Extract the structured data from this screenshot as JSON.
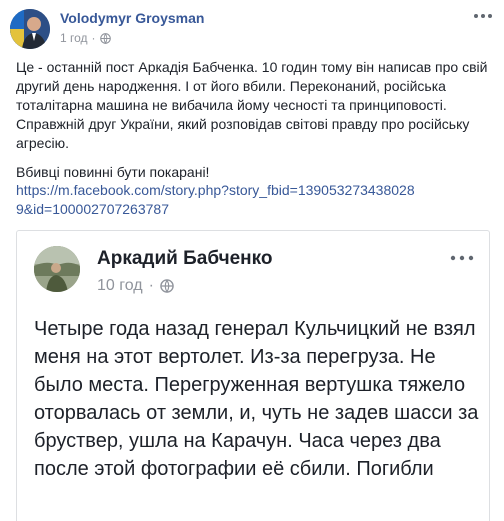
{
  "post": {
    "author": "Volodymyr Groysman",
    "time": "1 год",
    "dot": "·",
    "text_1": "Це - останній пост Аркадія Бабченка. 10 годин тому він написав про свій другий день народження. І от його вбили. Переконаний, російська тоталітарна машина не вибачила йому чесності та принциповості. Справжній друг України, який розповідав світові правду про російську агресію.",
    "text_2": "Вбивці повинні бути покарані!",
    "link": "https://m.facebook.com/story.php?story_fbid=1390532734380289&id=100002707263787"
  },
  "shared": {
    "author": "Аркадий Бабченко",
    "time": "10 год",
    "dot": "·",
    "text": "Четыре года назад генерал Кульчицкий не взял меня на этот вертолет. Из-за перегруза. Не было места. Перегруженная вертушка тяжело оторвалась от земли, и, чуть не задев шасси за бруствер, ушла на Карачун. Часа через два после этой фотографии её сбили. Погибли"
  },
  "icons": {
    "audience": "globe-icon",
    "menu": "more-horizontal-icon"
  },
  "colors": {
    "link": "#385898",
    "meta": "#90949c",
    "text": "#1d2129",
    "border": "#dddfe2"
  }
}
